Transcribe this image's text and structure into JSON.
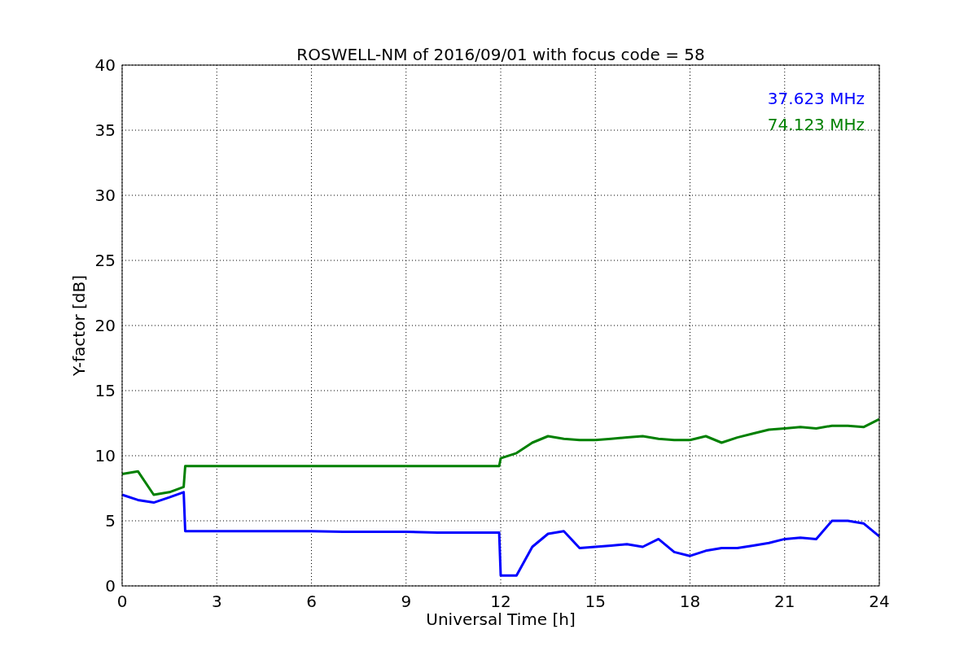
{
  "figure": {
    "chart_data": {
      "type": "line",
      "title": "ROSWELL-NM of 2016/09/01 with focus code = 58",
      "xlabel": "Universal Time [h]",
      "ylabel": "Y-factor [dB]",
      "x": [
        0,
        0.5,
        1,
        1.5,
        1.95,
        2,
        2.5,
        3,
        4,
        5,
        6,
        7,
        8,
        9,
        10,
        11,
        11.95,
        12,
        12.5,
        13,
        13.5,
        14,
        14.5,
        15,
        15.5,
        16,
        16.5,
        17,
        17.5,
        18,
        18.5,
        19,
        19.5,
        20,
        20.5,
        21,
        21.5,
        22,
        22.5,
        23,
        23.5,
        24
      ],
      "series": [
        {
          "name": "37.623 MHz",
          "color": "#0000ff",
          "values": [
            7,
            6.6,
            6.4,
            6.8,
            7.2,
            4.2,
            4.2,
            4.2,
            4.2,
            4.2,
            4.2,
            4.15,
            4.15,
            4.15,
            4.1,
            4.1,
            4.1,
            0.8,
            0.8,
            3,
            4,
            4.2,
            2.9,
            3,
            3.1,
            3.2,
            3,
            3.6,
            2.6,
            2.3,
            2.7,
            2.9,
            2.9,
            3.1,
            3.3,
            3.6,
            3.7,
            3.6,
            5,
            5,
            4.8,
            3.8
          ]
        },
        {
          "name": "74.123 MHz",
          "color": "#008000",
          "values": [
            8.6,
            8.8,
            7,
            7.2,
            7.6,
            9.2,
            9.2,
            9.2,
            9.2,
            9.2,
            9.2,
            9.2,
            9.2,
            9.2,
            9.2,
            9.2,
            9.2,
            9.8,
            10.2,
            11,
            11.5,
            11.3,
            11.2,
            11.2,
            11.3,
            11.4,
            11.5,
            11.3,
            11.2,
            11.2,
            11.5,
            11,
            11.4,
            11.7,
            12,
            12.1,
            12.2,
            12.1,
            12.3,
            12.3,
            12.2,
            12.8
          ]
        }
      ],
      "xlim": [
        0,
        24
      ],
      "ylim": [
        0,
        40
      ],
      "xticks": [
        0,
        3,
        6,
        9,
        12,
        15,
        18,
        21,
        24
      ],
      "yticks": [
        0,
        5,
        10,
        15,
        20,
        25,
        30,
        35,
        40
      ],
      "grid": true
    }
  }
}
